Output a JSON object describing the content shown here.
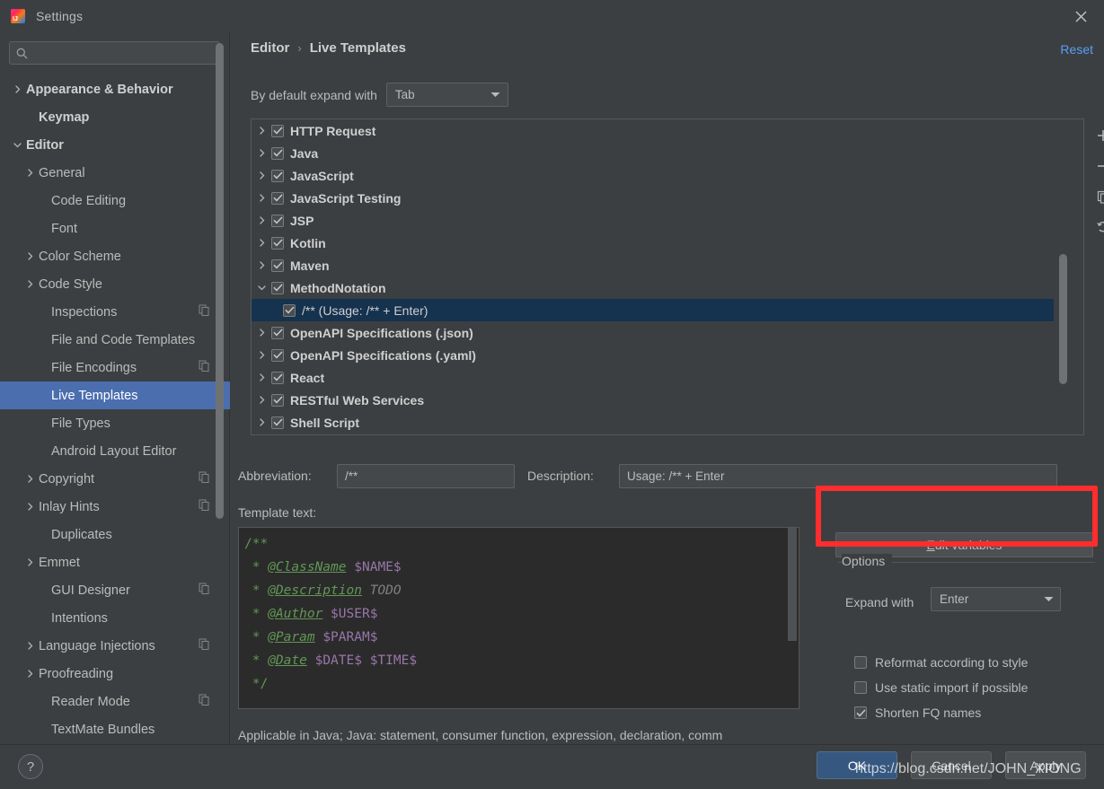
{
  "window": {
    "title": "Settings",
    "logo_icon": "intellij-idea-logo",
    "close_icon": "close-icon"
  },
  "sidebar": {
    "search": {
      "value": "",
      "placeholder": "",
      "icon": "search-icon"
    },
    "items": [
      {
        "label": "Appearance & Behavior",
        "level": 0,
        "arrow": "chevron-right",
        "bold": true,
        "copy": false,
        "selected": false
      },
      {
        "label": "Keymap",
        "level": 1,
        "arrow": "none",
        "bold": true,
        "copy": false,
        "selected": false
      },
      {
        "label": "Editor",
        "level": 0,
        "arrow": "chevron-down",
        "bold": true,
        "copy": false,
        "selected": false
      },
      {
        "label": "General",
        "level": 1,
        "arrow": "chevron-right",
        "bold": false,
        "copy": false,
        "selected": false
      },
      {
        "label": "Code Editing",
        "level": 2,
        "arrow": "none",
        "bold": false,
        "copy": false,
        "selected": false
      },
      {
        "label": "Font",
        "level": 2,
        "arrow": "none",
        "bold": false,
        "copy": false,
        "selected": false
      },
      {
        "label": "Color Scheme",
        "level": 1,
        "arrow": "chevron-right",
        "bold": false,
        "copy": false,
        "selected": false
      },
      {
        "label": "Code Style",
        "level": 1,
        "arrow": "chevron-right",
        "bold": false,
        "copy": false,
        "selected": false
      },
      {
        "label": "Inspections",
        "level": 2,
        "arrow": "none",
        "bold": false,
        "copy": true,
        "selected": false
      },
      {
        "label": "File and Code Templates",
        "level": 2,
        "arrow": "none",
        "bold": false,
        "copy": false,
        "selected": false
      },
      {
        "label": "File Encodings",
        "level": 2,
        "arrow": "none",
        "bold": false,
        "copy": true,
        "selected": false
      },
      {
        "label": "Live Templates",
        "level": 2,
        "arrow": "none",
        "bold": false,
        "copy": false,
        "selected": true
      },
      {
        "label": "File Types",
        "level": 2,
        "arrow": "none",
        "bold": false,
        "copy": false,
        "selected": false
      },
      {
        "label": "Android Layout Editor",
        "level": 2,
        "arrow": "none",
        "bold": false,
        "copy": false,
        "selected": false
      },
      {
        "label": "Copyright",
        "level": 1,
        "arrow": "chevron-right",
        "bold": false,
        "copy": true,
        "selected": false
      },
      {
        "label": "Inlay Hints",
        "level": 1,
        "arrow": "chevron-right",
        "bold": false,
        "copy": true,
        "selected": false
      },
      {
        "label": "Duplicates",
        "level": 2,
        "arrow": "none",
        "bold": false,
        "copy": false,
        "selected": false
      },
      {
        "label": "Emmet",
        "level": 1,
        "arrow": "chevron-right",
        "bold": false,
        "copy": false,
        "selected": false
      },
      {
        "label": "GUI Designer",
        "level": 2,
        "arrow": "none",
        "bold": false,
        "copy": true,
        "selected": false
      },
      {
        "label": "Intentions",
        "level": 2,
        "arrow": "none",
        "bold": false,
        "copy": false,
        "selected": false
      },
      {
        "label": "Language Injections",
        "level": 1,
        "arrow": "chevron-right",
        "bold": false,
        "copy": true,
        "selected": false
      },
      {
        "label": "Proofreading",
        "level": 1,
        "arrow": "chevron-right",
        "bold": false,
        "copy": false,
        "selected": false
      },
      {
        "label": "Reader Mode",
        "level": 2,
        "arrow": "none",
        "bold": false,
        "copy": true,
        "selected": false
      },
      {
        "label": "TextMate Bundles",
        "level": 2,
        "arrow": "none",
        "bold": false,
        "copy": false,
        "selected": false
      }
    ]
  },
  "main": {
    "breadcrumb": {
      "parent": "Editor",
      "separator": "›",
      "current": "Live Templates"
    },
    "reset_label": "Reset",
    "expand_with": {
      "label": "By default expand with",
      "value": "Tab"
    },
    "templates": [
      {
        "label": "HTTP Request",
        "checked": true,
        "group": true,
        "expanded": false,
        "selected": false
      },
      {
        "label": "Java",
        "checked": true,
        "group": true,
        "expanded": false,
        "selected": false
      },
      {
        "label": "JavaScript",
        "checked": true,
        "group": true,
        "expanded": false,
        "selected": false
      },
      {
        "label": "JavaScript Testing",
        "checked": true,
        "group": true,
        "expanded": false,
        "selected": false
      },
      {
        "label": "JSP",
        "checked": true,
        "group": true,
        "expanded": false,
        "selected": false
      },
      {
        "label": "Kotlin",
        "checked": true,
        "group": true,
        "expanded": false,
        "selected": false
      },
      {
        "label": "Maven",
        "checked": true,
        "group": true,
        "expanded": false,
        "selected": false
      },
      {
        "label": "MethodNotation",
        "checked": true,
        "group": true,
        "expanded": true,
        "selected": false
      },
      {
        "label": "/** (Usage: /** + Enter)",
        "checked": true,
        "group": false,
        "expanded": false,
        "selected": true
      },
      {
        "label": "OpenAPI Specifications (.json)",
        "checked": true,
        "group": true,
        "expanded": false,
        "selected": false
      },
      {
        "label": "OpenAPI Specifications (.yaml)",
        "checked": true,
        "group": true,
        "expanded": false,
        "selected": false
      },
      {
        "label": "React",
        "checked": true,
        "group": true,
        "expanded": false,
        "selected": false
      },
      {
        "label": "RESTful Web Services",
        "checked": true,
        "group": true,
        "expanded": false,
        "selected": false
      },
      {
        "label": "Shell Script",
        "checked": true,
        "group": true,
        "expanded": false,
        "selected": false
      }
    ],
    "list_toolbar": [
      {
        "icon": "plus-icon",
        "tooltip": "Add"
      },
      {
        "icon": "minus-icon",
        "tooltip": "Remove"
      },
      {
        "icon": "copy-icon",
        "tooltip": "Duplicate"
      },
      {
        "icon": "revert-icon",
        "tooltip": "Restore defaults"
      }
    ],
    "abbreviation": {
      "label": "Abbreviation:",
      "value": "/**"
    },
    "description": {
      "label": "Description:",
      "value": "Usage: /** + Enter"
    },
    "template_text": {
      "label": "Template text:",
      "lines": [
        {
          "segments": [
            {
              "t": "/**",
              "c": "cmt"
            }
          ]
        },
        {
          "segments": [
            {
              "t": " * ",
              "c": "cmt"
            },
            {
              "t": "@ClassName",
              "c": "tag"
            },
            {
              "t": " ",
              "c": "cmt"
            },
            {
              "t": "$NAME$",
              "c": "var"
            }
          ]
        },
        {
          "segments": [
            {
              "t": " * ",
              "c": "cmt"
            },
            {
              "t": "@Description",
              "c": "tag"
            },
            {
              "t": " ",
              "c": "cmt"
            },
            {
              "t": "TODO",
              "c": "todo"
            }
          ]
        },
        {
          "segments": [
            {
              "t": " * ",
              "c": "cmt"
            },
            {
              "t": "@Author",
              "c": "tag"
            },
            {
              "t": " ",
              "c": "cmt"
            },
            {
              "t": "$USER$",
              "c": "var"
            }
          ]
        },
        {
          "segments": [
            {
              "t": " * ",
              "c": "cmt"
            },
            {
              "t": "@Param",
              "c": "tag"
            },
            {
              "t": " ",
              "c": "cmt"
            },
            {
              "t": "$PARAM$",
              "c": "var"
            }
          ]
        },
        {
          "segments": [
            {
              "t": " * ",
              "c": "cmt"
            },
            {
              "t": "@Date",
              "c": "tag"
            },
            {
              "t": " ",
              "c": "cmt"
            },
            {
              "t": "$DATE$ $TIME$",
              "c": "var"
            }
          ]
        },
        {
          "segments": [
            {
              "t": " */",
              "c": "cmt"
            }
          ]
        }
      ]
    },
    "edit_variables_label": "Edit variables",
    "edit_variables_mnemonic": "E",
    "options": {
      "title": "Options",
      "expand_with": {
        "label": "Expand with",
        "value": "Enter"
      },
      "checkboxes": [
        {
          "label": "Reformat according to style",
          "checked": false
        },
        {
          "label": "Use static import if possible",
          "checked": false
        },
        {
          "label": "Shorten FQ names",
          "checked": true
        }
      ]
    },
    "applicable_text": "Applicable in Java; Java: statement, consumer function, expression, declaration, comm"
  },
  "footer": {
    "help_label": "?",
    "ok_label": "OK",
    "cancel_label": "Cancel",
    "apply_label": "Apply"
  },
  "watermark": "https://blog.csdn.net/JOHN_XIONG",
  "colors": {
    "window_bg": "#3c3f41",
    "accent_selection": "#4b6eaf",
    "list_selection": "#15324f",
    "link": "#589df6",
    "ok_button": "#365880",
    "annotation_red": "#ff2d2d",
    "editor_bg": "#2b2b2b",
    "code_comment": "#629755",
    "code_variable": "#9876aa"
  }
}
